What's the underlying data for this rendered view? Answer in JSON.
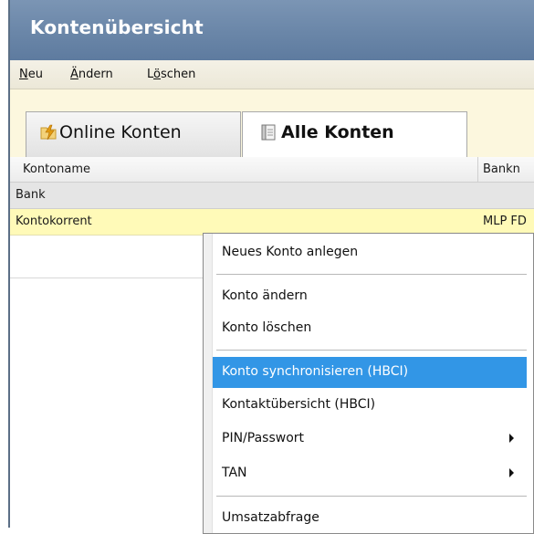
{
  "window": {
    "title": "Kontenübersicht"
  },
  "menu": {
    "items": [
      "Neu",
      "Ändern",
      "Löschen"
    ],
    "mnemonics": [
      "N",
      "Ä",
      "ö"
    ]
  },
  "tabs": [
    {
      "label": "Online Konten",
      "active": false,
      "icon": "lightning-folder-icon"
    },
    {
      "label": "Alle Konten",
      "active": true,
      "icon": "document-icon"
    }
  ],
  "grid": {
    "columns": [
      "Kontoname",
      "Bankn"
    ],
    "group_label": "Bank",
    "rows": [
      {
        "name": "Kontokorrent",
        "bank": "MLP FD"
      }
    ]
  },
  "context_menu": {
    "items": [
      {
        "label": "Neues Konto anlegen"
      },
      {
        "label": "Konto ändern"
      },
      {
        "label": "Konto löschen"
      },
      {
        "label": "Konto synchronisieren (HBCI)",
        "highlighted": true
      },
      {
        "label": "Kontaktübersicht (HBCI)"
      },
      {
        "label": "PIN/Passwort",
        "submenu": true
      },
      {
        "label": "TAN",
        "submenu": true
      },
      {
        "label": "Umsatzabfrage"
      }
    ],
    "highlight_color": "#3296e6"
  },
  "colors": {
    "title_bar": "#6a86a8",
    "selected_row": "#fffab8",
    "tab_strip": "#fcf7de"
  }
}
